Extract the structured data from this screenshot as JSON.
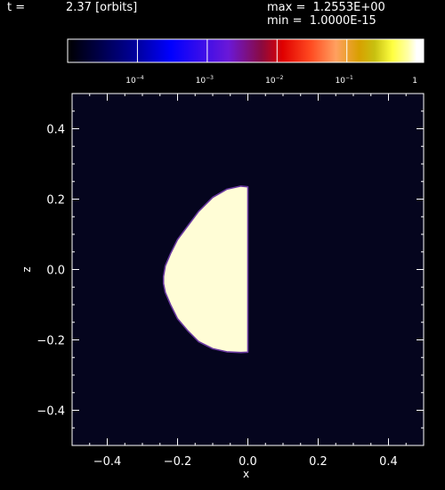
{
  "header": {
    "time_label": "t =",
    "time_value": "2.37 [orbits]",
    "max_text": "max =  1.2553E+00",
    "min_text": "min =  1.0000E-15"
  },
  "colorbar": {
    "ticks": [
      {
        "value": 0.0001,
        "base": "10",
        "exp": "−4"
      },
      {
        "value": 0.001,
        "base": "10",
        "exp": "−3"
      },
      {
        "value": 0.01,
        "base": "10",
        "exp": "−2"
      },
      {
        "value": 0.1,
        "base": "10",
        "exp": "−1"
      },
      {
        "value": 1,
        "base": "1",
        "exp": ""
      }
    ],
    "stops": [
      {
        "v": 1e-05,
        "color": "#000000"
      },
      {
        "v": 0.0001,
        "color": "#0000a0"
      },
      {
        "v": 0.0003,
        "color": "#0000ff"
      },
      {
        "v": 0.002,
        "color": "#6a18d8"
      },
      {
        "v": 0.006,
        "color": "#8a0a40"
      },
      {
        "v": 0.012,
        "color": "#e00000"
      },
      {
        "v": 0.03,
        "color": "#ff4a20"
      },
      {
        "v": 0.07,
        "color": "#ffa060"
      },
      {
        "v": 0.15,
        "color": "#d8a000"
      },
      {
        "v": 0.25,
        "color": "#c8c010"
      },
      {
        "v": 0.45,
        "color": "#ffff40"
      },
      {
        "v": 0.75,
        "color": "#ffffa8"
      },
      {
        "v": 1.0,
        "color": "#ffffff"
      }
    ]
  },
  "chart_data": {
    "type": "heatmap",
    "title": "",
    "xlabel": "x",
    "ylabel": "z",
    "xlim": [
      -0.5,
      0.5
    ],
    "ylim": [
      -0.5,
      0.5
    ],
    "xticks": [
      -0.4,
      -0.2,
      0.0,
      0.2,
      0.4
    ],
    "xtick_labels": [
      "−0.4",
      "−0.2",
      "0.0",
      "0.2",
      "0.4"
    ],
    "yticks": [
      -0.4,
      -0.2,
      0.0,
      0.2,
      0.4
    ],
    "ytick_labels": [
      "−0.4",
      "−0.2",
      "0.0",
      "0.2",
      "0.4"
    ],
    "background_value": 1e-15,
    "background_color": "#05051e",
    "region": {
      "description_value": 1.0,
      "fill_color": "#fffdd6",
      "edge_color": "#6a3aa0",
      "boundary_x": [
        0.0,
        -0.02,
        -0.06,
        -0.1,
        -0.14,
        -0.17,
        -0.2,
        -0.22,
        -0.235,
        -0.24,
        -0.24,
        -0.235,
        -0.22,
        -0.2,
        -0.17,
        -0.14,
        -0.1,
        -0.06,
        -0.02,
        0.0
      ],
      "boundary_z": [
        0.235,
        0.237,
        0.228,
        0.205,
        0.165,
        0.125,
        0.085,
        0.045,
        0.01,
        -0.02,
        -0.04,
        -0.065,
        -0.1,
        -0.14,
        -0.175,
        -0.205,
        -0.225,
        -0.234,
        -0.236,
        -0.235
      ]
    }
  }
}
